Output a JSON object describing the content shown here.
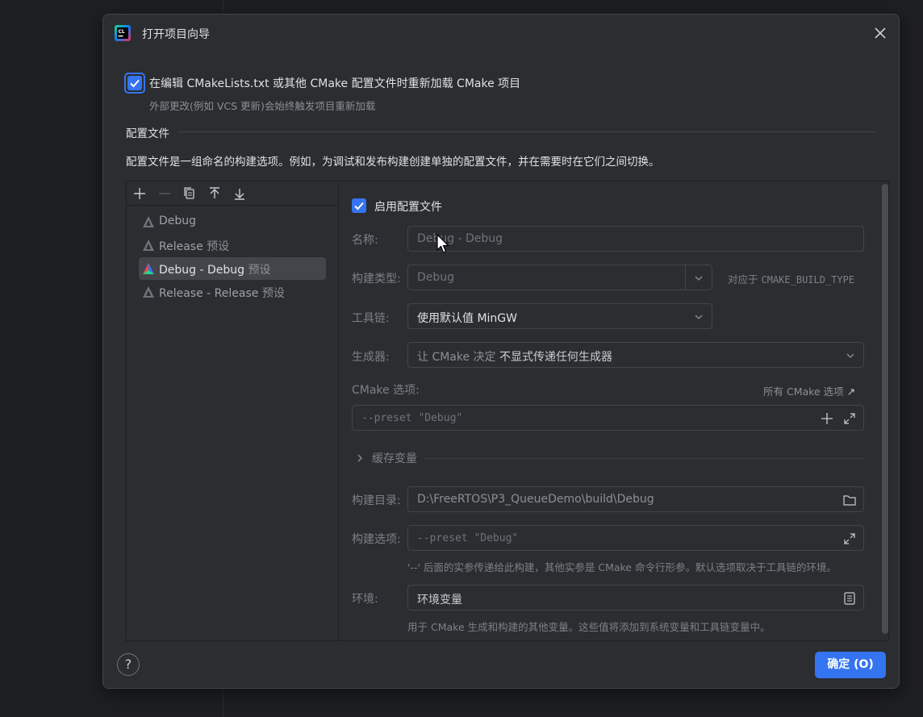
{
  "dialog": {
    "title": "打开项目向导",
    "reload": {
      "label": "在编辑 CMakeLists.txt 或其他 CMake 配置文件时重新加载 CMake 项目",
      "hint": "外部更改(例如 VCS 更新)会始终触发项目重新加载",
      "checked": true
    },
    "section": {
      "title": "配置文件",
      "description": "配置文件是一组命名的构建选项。例如，为调试和发布构建创建单独的配置文件，并在需要时在它们之间切换。"
    },
    "profiles": [
      {
        "name": "Debug",
        "suffix": ""
      },
      {
        "name": "Release",
        "suffix": "预设"
      },
      {
        "name": "Debug - Debug",
        "suffix": "预设",
        "selected": true
      },
      {
        "name": "Release - Release",
        "suffix": "预设"
      }
    ],
    "form": {
      "enable_label": "启用配置文件",
      "name": {
        "label": "名称:",
        "value": "Debug - Debug"
      },
      "build_type": {
        "label": "构建类型:",
        "value": "Debug",
        "hint_prefix": "对应于",
        "hint_var": "CMAKE_BUILD_TYPE"
      },
      "toolchain": {
        "label": "工具链:",
        "value_prefix": "使用默认值",
        "value": "MinGW"
      },
      "generator": {
        "label": "生成器:",
        "value_prefix": "让 CMake 决定",
        "value": "不显式传递任何生成器"
      },
      "cmake_options": {
        "label": "CMake 选项:",
        "all_link": "所有 CMake 选项",
        "value": "--preset \"Debug\""
      },
      "cache_vars": {
        "label": "缓存变量"
      },
      "build_dir": {
        "label": "构建目录:",
        "value": "D:\\FreeRTOS\\P3_QueueDemo\\build\\Debug"
      },
      "build_options": {
        "label": "构建选项:",
        "value": "--preset \"Debug\"",
        "hint": "'--' 后面的实参传递给此构建，其他实参是 CMake 命令行形参。默认选项取决于工具链的环境。"
      },
      "environment": {
        "label": "环境:",
        "value": "环境变量",
        "hint": "用于 CMake 生成和构建的其他变量。这些值将添加到系统变量和工具链变量中。"
      }
    },
    "help_label": "?",
    "ok_label": "确定 (O)"
  },
  "colors": {
    "accent": "#3574f0",
    "dialog_bg": "#2b2d30",
    "page_bg": "#1e1f22"
  }
}
